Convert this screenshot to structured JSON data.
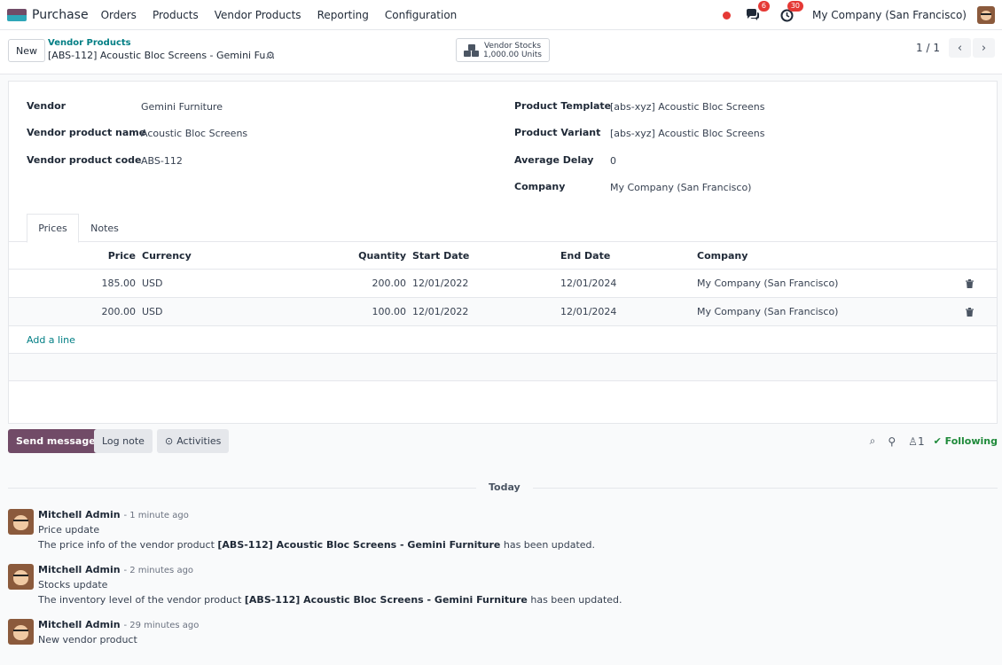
{
  "navbar": {
    "app_name": "Purchase",
    "menu": [
      "Orders",
      "Products",
      "Vendor Products",
      "Reporting",
      "Configuration"
    ],
    "messages_count": "6",
    "activities_count": "30",
    "company": "My Company (San Francisco)"
  },
  "control": {
    "new_label": "New",
    "breadcrumb_parent": "Vendor Products",
    "breadcrumb_current": "[ABS-112] Acoustic Bloc Screens - Gemini Fu…",
    "stat_title": "Vendor Stocks",
    "stat_value": "1,000.00 Units",
    "pager": "1 / 1"
  },
  "form": {
    "left": [
      {
        "label": "Vendor",
        "value": "Gemini Furniture"
      },
      {
        "label": "Vendor product name",
        "value": "Acoustic Bloc Screens"
      },
      {
        "label": "Vendor product code",
        "value": "ABS-112"
      }
    ],
    "right": [
      {
        "label": "Product Template",
        "value": "[abs-xyz] Acoustic Bloc Screens"
      },
      {
        "label": "Product Variant",
        "value": "[abs-xyz] Acoustic Bloc Screens"
      },
      {
        "label": "Average Delay",
        "value": "0"
      },
      {
        "label": "Company",
        "value": "My Company (San Francisco)"
      }
    ]
  },
  "tabs": [
    "Prices",
    "Notes"
  ],
  "prices": {
    "columns": {
      "price": "Price",
      "currency": "Currency",
      "quantity": "Quantity",
      "start": "Start Date",
      "end": "End Date",
      "company": "Company"
    },
    "rows": [
      {
        "price": "185.00",
        "currency": "USD",
        "quantity": "200.00",
        "start": "12/01/2022",
        "end": "12/01/2024",
        "company": "My Company (San Francisco)"
      },
      {
        "price": "200.00",
        "currency": "USD",
        "quantity": "100.00",
        "start": "12/01/2022",
        "end": "12/01/2024",
        "company": "My Company (San Francisco)"
      }
    ],
    "add_line": "Add a line"
  },
  "chatter": {
    "send_message": "Send message",
    "log_note": "Log note",
    "activities": "Activities",
    "followers_count": "1",
    "following": "Following",
    "date_separator": "Today",
    "messages": [
      {
        "author": "Mitchell Admin",
        "time": "- 1 minute ago",
        "line1": "Price update",
        "line2_pre": "The price info of the vendor product ",
        "line2_bold": "[ABS-112] Acoustic Bloc Screens - Gemini Furniture",
        "line2_post": " has been updated."
      },
      {
        "author": "Mitchell Admin",
        "time": "- 2 minutes ago",
        "line1": "Stocks update",
        "line2_pre": "The inventory level of the vendor product ",
        "line2_bold": "[ABS-112] Acoustic Bloc Screens - Gemini Furniture",
        "line2_post": " has been updated."
      },
      {
        "author": "Mitchell Admin",
        "time": "- 29 minutes ago",
        "line1": "New vendor product",
        "line2_pre": "",
        "line2_bold": "",
        "line2_post": ""
      }
    ]
  },
  "colors": {
    "brand": "#714b67",
    "link": "#017e84",
    "badge": "#e53935",
    "following": "#1f8a3a"
  }
}
